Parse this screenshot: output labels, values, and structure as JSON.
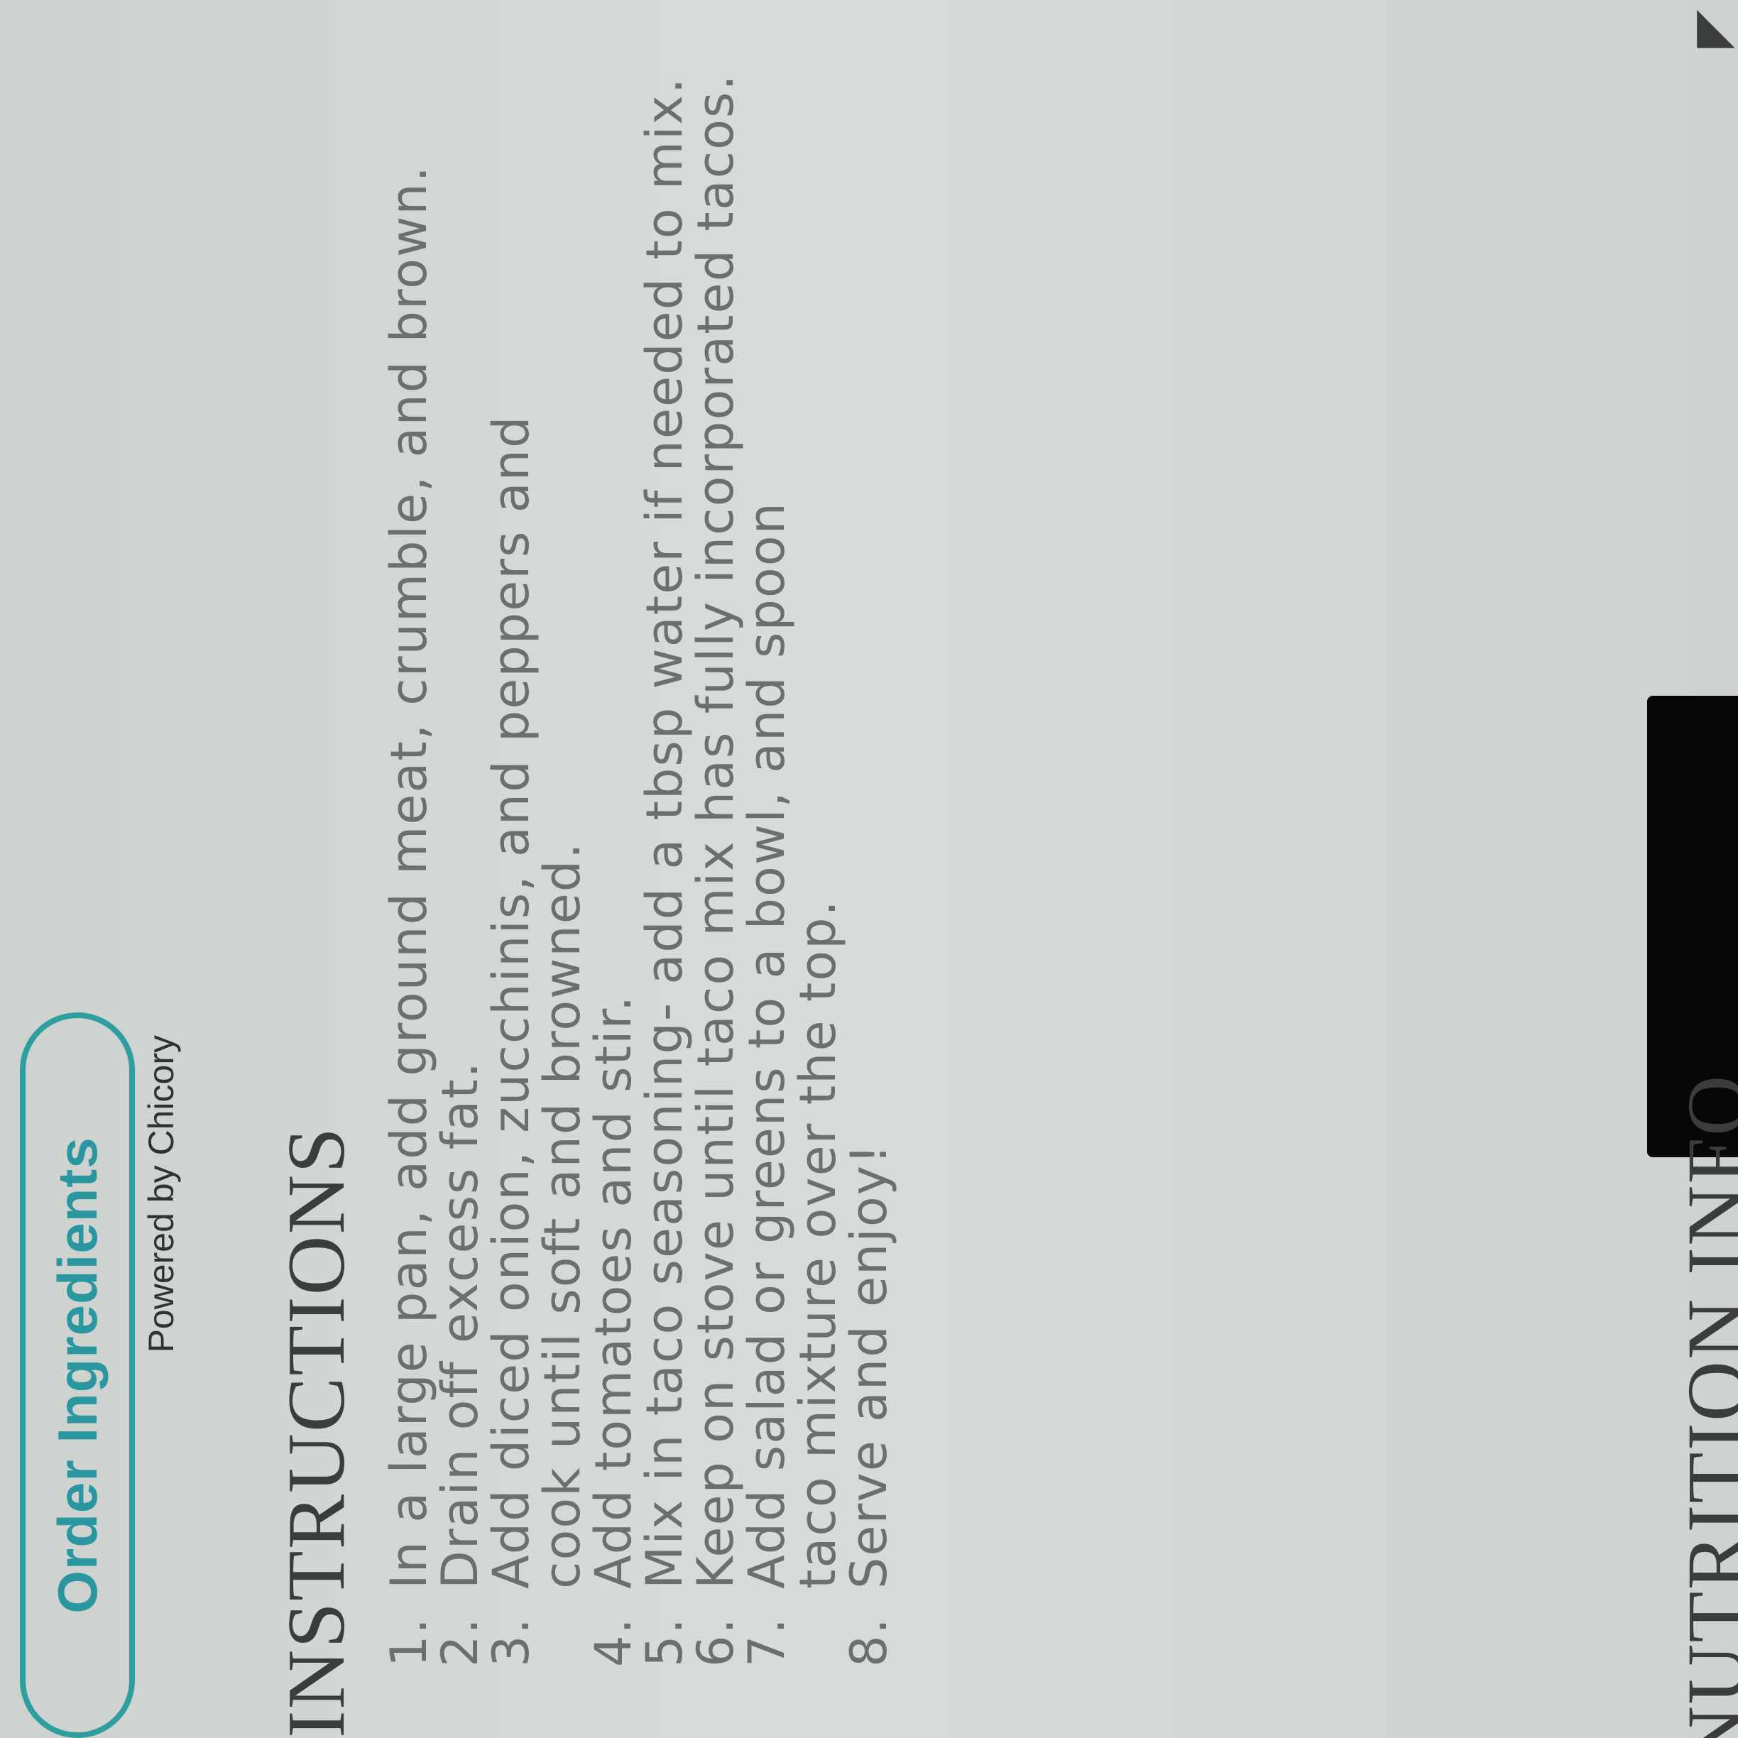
{
  "order_button": {
    "label": "Order Ingredients",
    "border_color": "#2f9ea0",
    "text_color": "#2a97a0"
  },
  "powered_by": "Powered by Chicory",
  "instructions": {
    "title": "INSTRUCTIONS",
    "steps": [
      {
        "number": "1.",
        "text": "In a large pan, add ground meat, crumble, and brown."
      },
      {
        "number": "2.",
        "text": "Drain off excess fat."
      },
      {
        "number": "3.",
        "text": "Add diced onion, zucchinis, and peppers and cook until soft and browned."
      },
      {
        "number": "4.",
        "text": "Add tomatoes and stir."
      },
      {
        "number": "5.",
        "text": "Mix in taco seasoning- add a tbsp water if needed to mix."
      },
      {
        "number": "6.",
        "text": "Keep on stove until taco mix has fully incorporated tacos."
      },
      {
        "number": "7.",
        "text": "Add salad or greens to a bowl, and spoon taco mixture over the top."
      },
      {
        "number": "8.",
        "text": "Serve and enjoy!"
      }
    ]
  },
  "nutrition_heading": "NUTRITION INFO",
  "icons": {
    "corner": "partial-icon"
  }
}
